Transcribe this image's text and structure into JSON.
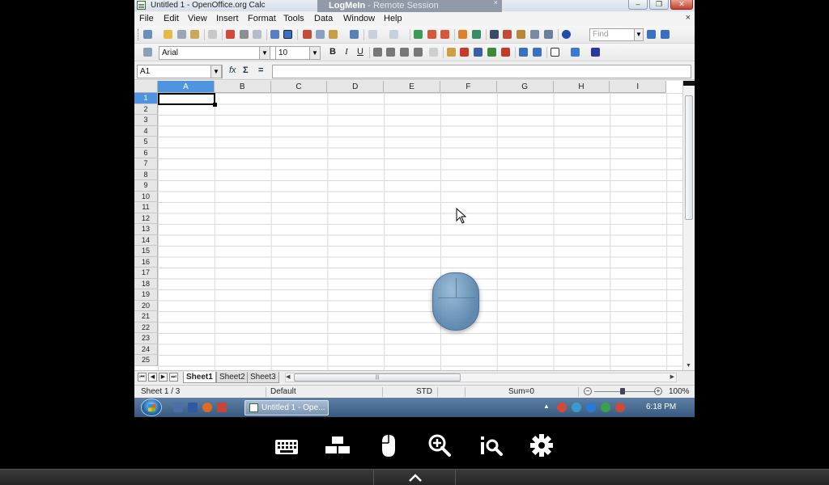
{
  "window": {
    "title": "Untitled 1 - OpenOffice.org Calc",
    "remote_banner_brand": "LogMeIn",
    "remote_banner_suffix": " - Remote Session",
    "banner_close": "×",
    "min_glyph": "–",
    "max_glyph": "❐",
    "close_glyph": "✕",
    "doc_close_glyph": "×"
  },
  "menu": [
    "File",
    "Edit",
    "View",
    "Insert",
    "Format",
    "Tools",
    "Data",
    "Window",
    "Help"
  ],
  "toolbar": {
    "find_placeholder": "Find",
    "font_name": "Arial",
    "font_size": "10",
    "bold": "B",
    "italic": "I",
    "underline": "U"
  },
  "formula_bar": {
    "name_box": "A1",
    "fx": "fx",
    "sum": "Σ",
    "equals": "=",
    "formula": ""
  },
  "grid": {
    "columns": [
      "A",
      "B",
      "C",
      "D",
      "E",
      "F",
      "G",
      "H",
      "I"
    ],
    "rows": [
      "1",
      "2",
      "3",
      "4",
      "5",
      "6",
      "7",
      "8",
      "9",
      "10",
      "11",
      "12",
      "13",
      "14",
      "15",
      "16",
      "17",
      "18",
      "19",
      "20",
      "21",
      "22",
      "23",
      "24",
      "25"
    ],
    "selected_column": "A",
    "selected_row": "1"
  },
  "sheets": {
    "tabs": [
      "Sheet1",
      "Sheet2",
      "Sheet3"
    ],
    "active": "Sheet1",
    "nav": [
      "⏮",
      "◀",
      "▶",
      "⏭"
    ]
  },
  "status": {
    "sheet": "Sheet 1 / 3",
    "page_style": "Default",
    "mode": "STD",
    "sum": "Sum=0",
    "zoom": "100%",
    "zoom_minus": "−",
    "zoom_plus": "+"
  },
  "taskbar": {
    "task_label": "Untitled 1 - Ope...",
    "clock": "6:18 PM"
  },
  "controls": [
    "keyboard-icon",
    "display-icon",
    "mouse-icon",
    "zoom-icon",
    "info-search-icon",
    "settings-icon"
  ],
  "colors": {
    "selection_header": "#4f94e0",
    "taskbar": "#385a80",
    "control_bar": "#000000"
  }
}
